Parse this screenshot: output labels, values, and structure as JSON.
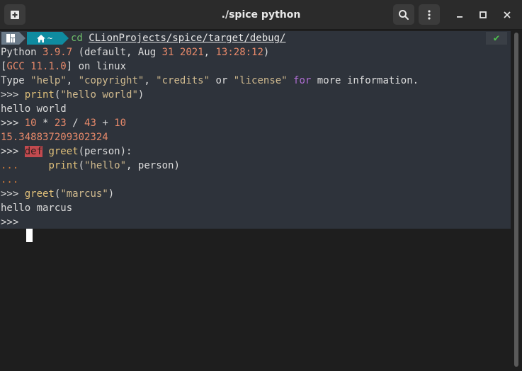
{
  "window": {
    "title": "./spice python",
    "buttons": {
      "new_tab_icon": "new-tab-icon",
      "search_icon": "search-icon",
      "menu_icon": "menu-icon",
      "minimize_glyph": "–",
      "maximize_glyph": "□",
      "close_glyph": "✕"
    }
  },
  "prompt": {
    "os_glyph": "⎇",
    "home_glyph": "⌂",
    "home_label": "~",
    "command": "cd",
    "path": "CLionProjects/spice/target/debug/",
    "status_glyph": "✔"
  },
  "session": {
    "line1_a": "Python ",
    "line1_version": "3.9.7",
    "line1_b": " (default, Aug ",
    "line1_day": "31",
    "line1_c": " ",
    "line1_year": "2021",
    "line1_d": ", ",
    "line1_time": "13:28:12",
    "line1_e": ")",
    "line2_a": "[",
    "line2_gcc": "GCC 11.1.0",
    "line2_b": "] on linux",
    "line3_a": "Type ",
    "line3_help": "\"help\"",
    "line3_b": ", ",
    "line3_copyright": "\"copyright\"",
    "line3_c": ", ",
    "line3_credits": "\"credits\"",
    "line3_d": " or ",
    "line3_license": "\"license\"",
    "line3_e": " ",
    "line3_for": "for",
    "line3_f": " more information.",
    "prompt_primary": ">>> ",
    "prompt_cont": "... ",
    "cmd1_fn": "print",
    "cmd1_open": "(",
    "cmd1_str": "\"hello world\"",
    "cmd1_close": ")",
    "out1": "hello world",
    "cmd2_n1": "10",
    "cmd2_op1": " * ",
    "cmd2_n2": "23",
    "cmd2_op2": " / ",
    "cmd2_n3": "43",
    "cmd2_op3": " + ",
    "cmd2_n4": "10",
    "out2": "15.348837209302324",
    "def_kw": "def",
    "def_rest_fn": " greet",
    "def_rest": "(person):",
    "body_indent": "    ",
    "body_fn": "print",
    "body_open": "(",
    "body_str": "\"hello\"",
    "body_rest": ", person)",
    "cont_empty": "...",
    "cmd3_fn": "greet",
    "cmd3_open": "(",
    "cmd3_str": "\"marcus\"",
    "cmd3_close": ")",
    "out3": "hello marcus",
    "last_prompt": ">>>"
  }
}
